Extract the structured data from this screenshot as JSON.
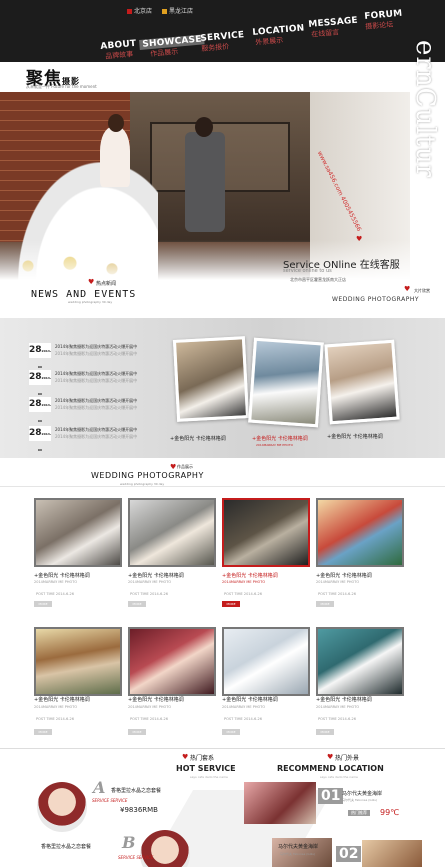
{
  "header": {
    "store1": "北京店",
    "store2": "黑龙江店",
    "store1_color": "#c41c1c",
    "store2_color": "#e0a020",
    "logo": "聚焦",
    "logo_latin": "摄影",
    "logo_sub": "从未就是一件 Future for the moment",
    "nav": [
      {
        "en": "ABOUT",
        "cn": "品牌故事"
      },
      {
        "en": "SHOWCASE",
        "cn": "作品展示"
      },
      {
        "en": "SERVICE",
        "cn": "服务报价"
      },
      {
        "en": "LOCATION",
        "cn": "外景展示"
      },
      {
        "en": "MESSAGE",
        "cn": "在线留言"
      },
      {
        "en": "FORUM",
        "cn": "摄影论坛"
      }
    ]
  },
  "hero": {
    "vertical_text": "ernCultur",
    "vertical_red": "www.sa456.com 4005455566",
    "service_title": "Service ONline 在线客服",
    "service_sub": "service online to us",
    "service_addr": "北京市昌平区霍营龙跃南大正店"
  },
  "news": {
    "title": "NEWS AND EVENTS",
    "tag": "热点新闻",
    "sub": "wedding photography 30 day",
    "items": [
      {
        "day": "28",
        "ym": "2014-06",
        "l1": "2014年聚焦摄影为迎国庆特惠活动火爆开展中",
        "l2": "2014年聚焦摄影为迎国庆特惠活动火爆开展中"
      },
      {
        "day": "28",
        "ym": "2014-06",
        "l1": "2014年聚焦摄影为迎国庆特惠活动火爆开展中",
        "l2": "2014年聚焦摄影为迎国庆特惠活动火爆开展中"
      },
      {
        "day": "28",
        "ym": "2014-06",
        "l1": "2014年聚焦摄影为迎国庆特惠活动火爆开展中",
        "l2": "2014年聚焦摄影为迎国庆特惠活动火爆开展中"
      },
      {
        "day": "28",
        "ym": "2014-06",
        "l1": "2014年聚焦摄影为迎国庆特惠活动火爆开展中",
        "l2": "2014年聚焦摄影为迎国庆特惠活动火爆开展中"
      }
    ]
  },
  "wedding_top": {
    "title": "WEDDING PHOTOGRAPHY",
    "tag": "大片欣赏",
    "items": [
      {
        "cap": "+金色阳光 卡伦格林格调",
        "sub": "2014MARRAY ME PHOTO",
        "active": false
      },
      {
        "cap": "+金色阳光 卡伦格林格调",
        "sub": "2014MARRAY ME PHOTO",
        "active": true
      },
      {
        "cap": "+金色阳光 卡伦格林格调",
        "sub": "2014MARRAY ME PHOTO",
        "active": false
      }
    ]
  },
  "gallery": {
    "title": "WEDDING PHOTOGRAPHY",
    "tag": "作品展示",
    "sub": "wedding photography 30 day",
    "items": [
      {
        "title": "+金色阳光 卡伦格林格调",
        "sub": "2014MARRAY ME PHOTO",
        "post": "POST TIME 2014-6-26",
        "more": "MORE",
        "active": false
      },
      {
        "title": "+金色阳光 卡伦格林格调",
        "sub": "2014MARRAY ME PHOTO",
        "post": "POST TIME 2014-6-26",
        "more": "MORE",
        "active": false
      },
      {
        "title": "+金色阳光 卡伦格林格调",
        "sub": "2014MARRAY ME PHOTO",
        "post": "POST TIME 2014-6-26",
        "more": "MORE",
        "active": true
      },
      {
        "title": "+金色阳光 卡伦格林格调",
        "sub": "2014MARRAY ME PHOTO",
        "post": "POST TIME 2014-6-26",
        "more": "MORE",
        "active": false
      },
      {
        "title": "+金色阳光 卡伦格林格调",
        "sub": "2014MARRAY ME PHOTO",
        "post": "POST TIME 2014-6-26",
        "more": "MORE",
        "active": false
      },
      {
        "title": "+金色阳光 卡伦格林格调",
        "sub": "2014MARRAY ME PHOTO",
        "post": "POST TIME 2014-6-26",
        "more": "MORE",
        "active": false
      },
      {
        "title": "+金色阳光 卡伦格林格调",
        "sub": "2014MARRAY ME PHOTO",
        "post": "POST TIME 2014-6-26",
        "more": "MORE",
        "active": false
      },
      {
        "title": "+金色阳光 卡伦格林格调",
        "sub": "2014MARRAY ME PHOTO",
        "post": "POST TIME 2014-6-26",
        "more": "MORE",
        "active": false
      }
    ]
  },
  "hot": {
    "tag": "热门套系",
    "title": "HOT SERVICE",
    "sub": "says cafe dedo the name",
    "a_letter": "A",
    "a_title": "香格里拉水晶之恋套餐",
    "a_sub": "SERVICE SERVICE",
    "a_price": "¥9836RMB",
    "b_letter": "B",
    "b_title": "香格里拉水晶之恋套餐",
    "b_sub": "SERVICE SERVICE"
  },
  "recommend": {
    "tag": "热门外景",
    "title": "RECOMMEND LOCATION",
    "sub": "says cafe dedo the name",
    "items": [
      {
        "num": "01",
        "name": "马尔代夫黄金海岸",
        "sub": "马尔代夫 Fabonsa (Gilis)",
        "badge": "热门推荐",
        "price": "99℃"
      },
      {
        "num": "02",
        "name": "马尔代夫黄金海岸",
        "sub": "马尔代夫 Fabonsa (Gilis)"
      }
    ]
  }
}
